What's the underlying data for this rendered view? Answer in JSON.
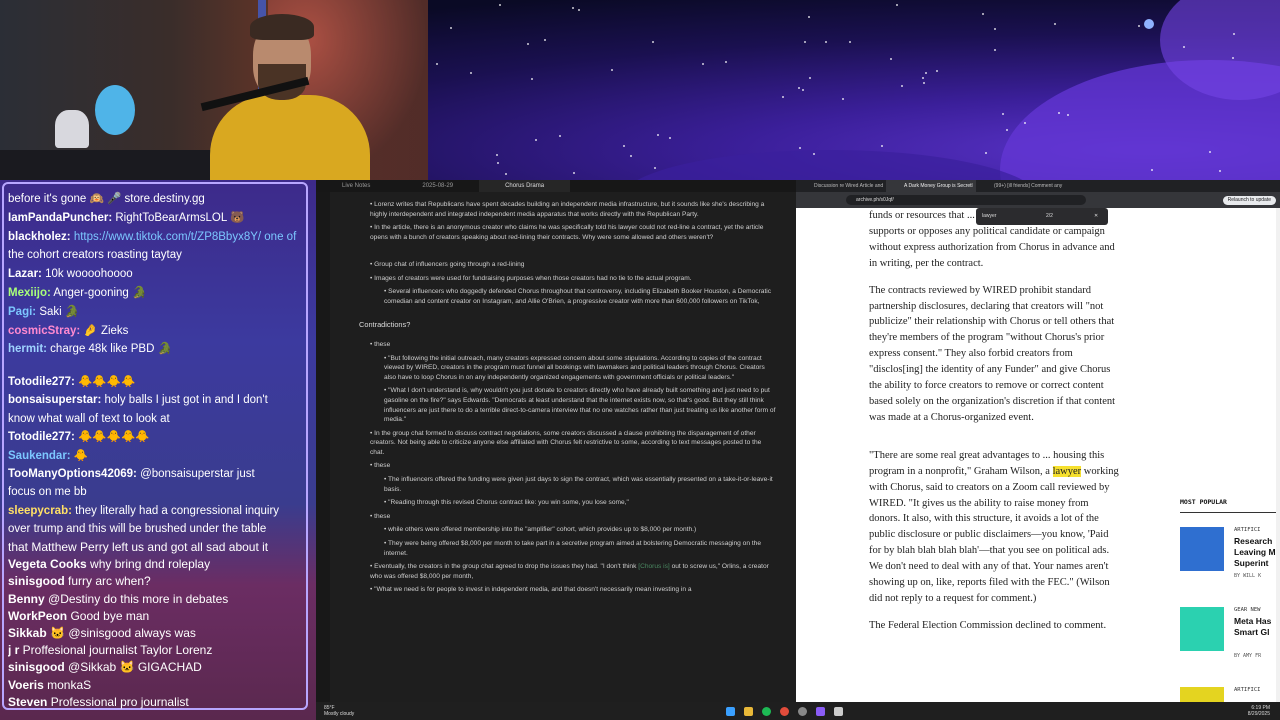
{
  "chat_top": [
    {
      "user": "",
      "text": "before it's gone  🙉 🎤 store.destiny.gg",
      "color": "#ffffff"
    },
    {
      "user": "IamPandaPuncher:",
      "text": " RightToBearArmsLOL 🐻",
      "color": "#ffffff"
    },
    {
      "user": "blackholez:",
      "text": " https://www.tiktok.com/t/ZP8Bbyx8Y/ one of",
      "color": "#ffffff",
      "link": true
    },
    {
      "user": "",
      "text": "the cohort creators roasting taytay",
      "color": "#ffffff"
    },
    {
      "user": "Lazar:",
      "text": " 10k woooohoooo",
      "color": "#ffffff"
    },
    {
      "user": "Mexiijo:",
      "text": " Anger-gooning 🐊",
      "color": "#a8ff7a"
    },
    {
      "user": "Pagi:",
      "text": " Saki 🐊",
      "color": "#7cc7ff"
    },
    {
      "user": "cosmicStray:",
      "text": " 🤌 Zieks",
      "color": "#ff8ad0"
    },
    {
      "user": "hermit:",
      "text": " charge 48k like PBD 🐊",
      "color": "#9fd3ff"
    }
  ],
  "chat_mid": [
    {
      "user": "Totodile277:",
      "text": " 🐥🐥🐥🐥",
      "color": "#ffffff"
    },
    {
      "user": "bonsaisuperstar:",
      "text": " holy balls I just got in and I don't",
      "color": "#ffffff"
    },
    {
      "user": "",
      "text": "know what wall of text to look at",
      "color": "#ffffff"
    },
    {
      "user": "Totodile277:",
      "text": " 🐥🐥🐥🐥🐥",
      "color": "#ffffff"
    },
    {
      "user": "Saukendar:",
      "text": " 🐥",
      "color": "#7cc7ff"
    },
    {
      "user": "TooManyOptions42069:",
      "text": " @bonsaisuperstar just",
      "color": "#ffffff"
    },
    {
      "user": "",
      "text": "focus on me bb",
      "color": "#ffffff"
    },
    {
      "user": "sleepycrab:",
      "text": " they literally had a congressional inquiry",
      "color": "#ffe066"
    },
    {
      "user": "",
      "text": "over trump and this will be brushed under the table",
      "color": "#ffffff"
    }
  ],
  "chat_bottom": [
    {
      "user": "",
      "text": "that Matthew Perry left us and got all sad about it",
      "color": "#ffffff"
    },
    {
      "user": "Vegeta Cooks",
      "text": " why bring dnd roleplay",
      "color": "#ffffff"
    },
    {
      "user": "sinisgood",
      "text": " furry arc when?",
      "color": "#ffffff"
    },
    {
      "user": "Benny",
      "text": " @Destiny do this more in debates",
      "color": "#ffffff"
    },
    {
      "user": "WorkPeon",
      "text": " Good bye man",
      "color": "#ffffff"
    },
    {
      "user": "Sikkab",
      "text": " 🐱 @sinisgood always was",
      "color": "#ffffff"
    },
    {
      "user": "j r",
      "text": " Proffesional journalist Taylor Lorenz",
      "color": "#ffffff"
    },
    {
      "user": "sinisgood",
      "text": " @Sikkab 🐱 GIGACHAD",
      "color": "#ffffff"
    },
    {
      "user": "Voeris",
      "text": " monkaS",
      "color": "#ffffff"
    },
    {
      "user": "Steven",
      "text": " Professional pro journalist",
      "color": "#ffffff"
    }
  ],
  "notes": {
    "tabs": [
      "Live Notes",
      "2025-08-29",
      "Chorus Drama"
    ],
    "paragraphs": [
      {
        "level": 1,
        "text": "Lorenz writes that Republicans have spent decades building an independent media infrastructure, but it sounds like she's describing a highly interdependent and integrated independent media apparatus that works directly with the Republican Party."
      },
      {
        "level": 1,
        "text": "In the article, there is an anonymous creator who claims he was specifically told his lawyer could not red-line a contract, yet the article opens with a bunch of creators speaking about red-lining their contracts. Why were some allowed and others weren't?"
      },
      {
        "level": 0,
        "text": ""
      },
      {
        "level": 1,
        "text": "Group chat of influencers going through a red-lining"
      },
      {
        "level": 1,
        "text": "Images of creators were used for fundraising purposes when those creators had no tie to the actual program."
      },
      {
        "level": 2,
        "text": "Several influencers who doggedly defended Chorus throughout that controversy, including Elizabeth Booker Houston, a Democratic comedian and content creator on Instagram, and Allie O'Brien, a progressive creator with more than 600,000 followers on TikTok,"
      },
      {
        "level": -1,
        "text": "Contradictions?"
      },
      {
        "level": 1,
        "text": "these"
      },
      {
        "level": 2,
        "text": "\"But following the initial outreach, many creators expressed concern about some stipulations. According to copies of the contract viewed by WIRED, creators in the program must funnel all bookings with lawmakers and political leaders through Chorus. Creators also have to loop Chorus in on any independently organized engagements with government officials or political leaders.\""
      },
      {
        "level": 2,
        "text": "\"What I don't understand is, why wouldn't you just donate to creators directly who have already built something and just need to put gasoline on the fire?\" says Edwards. \"Democrats at least understand that the internet exists now, so that's good. But they still think influencers are just there to do a terrible direct-to-camera interview that no one watches rather than just treating us like another form of media.\""
      },
      {
        "level": 1,
        "text": "In the group chat formed to discuss contract negotiations, some creators discussed a clause prohibiting the disparagement of other creators. Not being able to criticize anyone else affiliated with Chorus felt restrictive to some, according to text messages posted to the chat."
      },
      {
        "level": 1,
        "text": "these"
      },
      {
        "level": 2,
        "text": "The influencers offered the funding were given just days to sign the contract, which was essentially presented on a take-it-or-leave-it basis."
      },
      {
        "level": 2,
        "text": "\"Reading through this revised Chorus contract like: you win some, you lose some,\""
      },
      {
        "level": 1,
        "text": "these"
      },
      {
        "level": 2,
        "text": "while others were offered membership into the \"amplifier\" cohort, which provides up to $8,000 per month.)"
      },
      {
        "level": 2,
        "text": "They were being offered $8,000 per month to take part in a secretive program aimed at bolstering Democratic messaging on the internet."
      },
      {
        "level": 1,
        "text": "Eventually, the creators in the group chat agreed to drop the issues they had. \"I don't think [Chorus is] out to screw us,\" Orlins, a creator who was offered $8,000 per month,"
      },
      {
        "level": 1,
        "text": "\"What we need is for people to invest in independent media, and that doesn't necessarily mean investing in a"
      }
    ]
  },
  "browser": {
    "tabs": [
      "Discussion re Wired Article and",
      "A Dark Money Group is Secretl",
      "(99+) [ill friends] Comment any"
    ],
    "url": "archive.ph/s0Jqf/",
    "update_label": "Relaunch to update",
    "find_query": "lawyer",
    "find_count": "2/2",
    "paragraphs": [
      "funds or resources that ... program to make content that supports or opposes any political candidate or campaign without express authorization from Chorus in advance and in writing, per the contract.",
      "The contracts reviewed by WIRED prohibit standard partnership disclosures, declaring that creators will \"not publicize\" their relationship with Chorus or tell others that they're members of the program \"without Chorus's prior express consent.\" They also forbid creators from \"disclos[ing] the identity of any Funder\" and give Chorus the ability to force creators to remove or correct content based solely on the organization's discretion if that content was made at a Chorus-organized event.",
      "\"There are some real great advantages to ... housing this program in a nonprofit,\" Graham Wilson, a ||lawyer|| working with Chorus, said to creators on a Zoom call reviewed by WIRED. \"It gives us the ability to raise money from donors. It also, with this structure, it avoids a lot of the public disclosure or public disclaimers—you know, 'Paid for by blah blah blah blah'—that you see on political ads. We don't need to deal with any of that. Your names aren't showing up on, like, reports filed with the FEC.\" (Wilson did not reply to a request for comment.)",
      "The Federal Election Commission declined to comment."
    ],
    "highlight": "lawyer",
    "popular": {
      "heading": "MOST POPULAR",
      "items": [
        {
          "category": "ARTIFICI",
          "title": "Research\nLeaving M\nSuperint",
          "byline": "BY WILL K"
        },
        {
          "category": "GEAR NEW",
          "title": "Meta Has\nSmart Gl",
          "byline": "BY AMY FR"
        },
        {
          "category": "ARTIFICI",
          "title": "",
          "byline": ""
        }
      ]
    }
  },
  "taskbar": {
    "weather_temp": "85°F",
    "weather_desc": "Mostly cloudy",
    "time": "6:19 PM",
    "date": "8/29/2025"
  }
}
